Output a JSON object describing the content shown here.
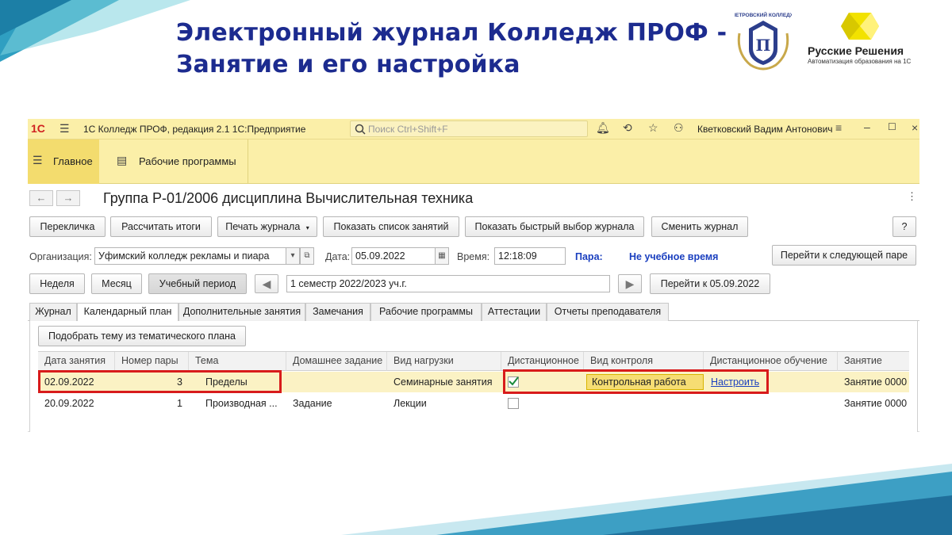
{
  "slide": {
    "title_line1": "Электронный журнал Колледж ПРОФ -",
    "title_line2": "Занятие и его настройка",
    "college_logo_text": "ПЕТРОВСКИЙ КОЛЛЕДЖ",
    "rr_logo_name": "Русские Решения",
    "rr_logo_sub": "Автоматизация образования на 1С",
    "accent_color": "#1c2b8f"
  },
  "topbar": {
    "logo": "1С",
    "app_title": "1С Колледж ПРОФ, редакция 2.1 1С:Предприятие",
    "search_placeholder": "Поиск Ctrl+Shift+F",
    "user": "Кветковский Вадим Антонович",
    "icons": [
      "menu-icon",
      "search-icon",
      "bell-icon",
      "history-icon",
      "star-icon",
      "user-icon",
      "settings-icon",
      "minimize-icon",
      "maximize-icon",
      "close-icon"
    ]
  },
  "sections": {
    "main": "Главное",
    "programs": "Рабочие программы"
  },
  "form": {
    "title": "Группа Р-01/2006 дисциплина Вычислительная техника",
    "back": "←",
    "forward": "→",
    "more": "⋮"
  },
  "toolbar": {
    "rollcall": "Перекличка",
    "calc_totals": "Рассчитать итоги",
    "print_journal": "Печать журнала",
    "show_lessons": "Показать список занятий",
    "quick_select": "Показать быстрый выбор журнала",
    "change_journal": "Сменить журнал",
    "help": "?"
  },
  "params": {
    "org_label": "Организация:",
    "org_value": "Уфимский колледж рекламы и пиара",
    "date_label": "Дата:",
    "date_value": "05.09.2022",
    "time_label": "Время:",
    "time_value": "12:18:09",
    "pair_label": "Пара:",
    "pair_value": "Не учебное время",
    "next_pair": "Перейти к следующей паре"
  },
  "period": {
    "week": "Неделя",
    "month": "Месяц",
    "study_period": "Учебный период",
    "period_value": "1 семестр 2022/2023 уч.г.",
    "goto_date": "Перейти к 05.09.2022"
  },
  "tabs": [
    "Журнал",
    "Календарный план",
    "Дополнительные занятия",
    "Замечания",
    "Рабочие программы",
    "Аттестации",
    "Отчеты преподавателя"
  ],
  "calendar": {
    "pick_topic": "Подобрать тему из тематического плана",
    "columns": [
      "Дата занятия",
      "Номер пары",
      "Тема",
      "Домашнее задание",
      "Вид нагрузки",
      "Дистанционное",
      "Вид контроля",
      "Дистанционное обучение",
      "Занятие"
    ],
    "rows": [
      {
        "date": "02.09.2022",
        "pair": "3",
        "topic": "Пределы",
        "homework": "",
        "load": "Семинарные занятия",
        "distance": true,
        "control": "Контрольная работа",
        "distance_learning": "Настроить",
        "lesson": "Занятие 0000"
      },
      {
        "date": "20.09.2022",
        "pair": "1",
        "topic": "Производная ...",
        "homework": "Задание",
        "load": "Лекции",
        "distance": false,
        "control": "",
        "distance_learning": "",
        "lesson": "Занятие 0000"
      }
    ]
  }
}
